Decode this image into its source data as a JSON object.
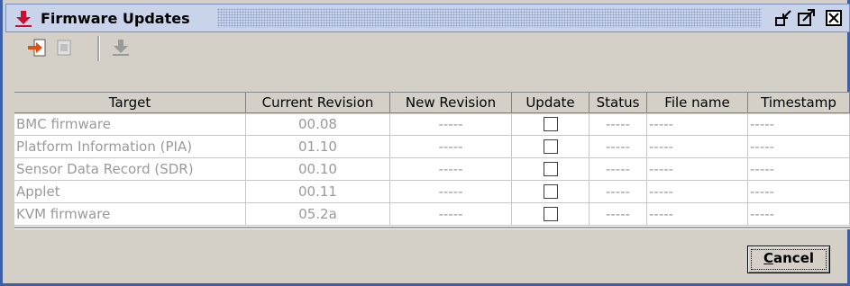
{
  "window": {
    "title": "Firmware Updates",
    "icon": "download-arrow-icon",
    "controls": [
      "minimize-icon",
      "maximize-icon",
      "close-icon"
    ]
  },
  "toolbar": {
    "tools": [
      {
        "name": "import-file-tool",
        "icon": "import-arrow-icon",
        "enabled": true
      },
      {
        "name": "document-tool",
        "icon": "document-icon",
        "enabled": false
      },
      {
        "name": "download-tool",
        "icon": "download-arrow-icon",
        "enabled": false
      }
    ]
  },
  "table": {
    "columns": [
      "Target",
      "Current Revision",
      "New Revision",
      "Update",
      "Status",
      "File name",
      "Timestamp"
    ],
    "rows": [
      {
        "target": "BMC firmware",
        "current": "00.08",
        "new": "-----",
        "update": false,
        "status": "-----",
        "file": "-----",
        "timestamp": "-----"
      },
      {
        "target": "Platform Information (PIA)",
        "current": "01.10",
        "new": "-----",
        "update": false,
        "status": "-----",
        "file": "-----",
        "timestamp": "-----"
      },
      {
        "target": "Sensor Data Record (SDR)",
        "current": "00.10",
        "new": "-----",
        "update": false,
        "status": "-----",
        "file": "-----",
        "timestamp": "-----"
      },
      {
        "target": "Applet",
        "current": "00.11",
        "new": "-----",
        "update": false,
        "status": "-----",
        "file": "-----",
        "timestamp": "-----"
      },
      {
        "target": "KVM firmware",
        "current": "05.2a",
        "new": "-----",
        "update": false,
        "status": "-----",
        "file": "-----",
        "timestamp": "-----"
      }
    ]
  },
  "buttons": {
    "cancel_mnemonic": "C",
    "cancel_rest": "ancel"
  },
  "colors": {
    "title_accent": "#3c5fa8",
    "disabled_text": "#9a9a9a",
    "icon_red": "#c8102e"
  }
}
